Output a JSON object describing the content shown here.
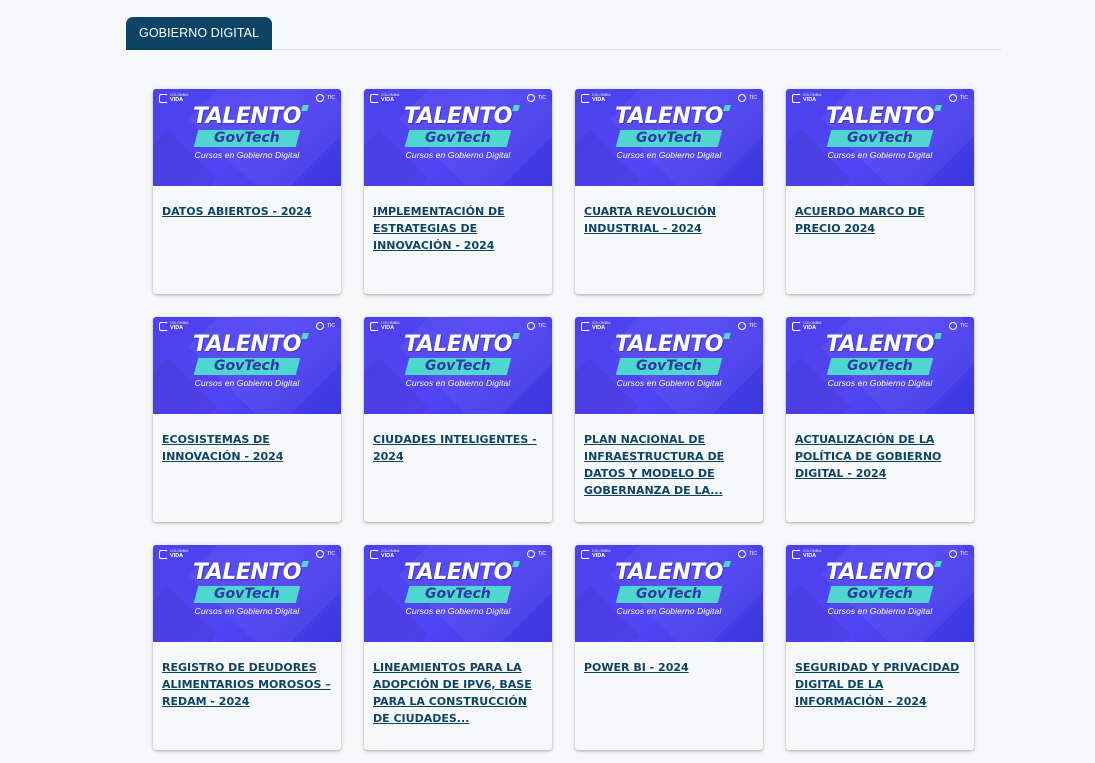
{
  "tab": {
    "label": "GOBIERNO DIGITAL"
  },
  "banner": {
    "logo_left_small": "COLOMBIA",
    "logo_left_big": "VIDA",
    "logo_right": "TIC",
    "brand": "TALENTO",
    "brand_sub": "GovTech",
    "caption": "Cursos en Gobierno Digital"
  },
  "courses": [
    {
      "title": "DATOS ABIERTOS - 2024"
    },
    {
      "title": "IMPLEMENTACIÓN DE ESTRATEGIAS DE INNOVACIÓN - 2024"
    },
    {
      "title": "CUARTA REVOLUCIÓN INDUSTRIAL - 2024"
    },
    {
      "title": "ACUERDO MARCO DE PRECIO 2024"
    },
    {
      "title": "ECOSISTEMAS DE INNOVACIÓN - 2024"
    },
    {
      "title": "CIUDADES INTELIGENTES - 2024"
    },
    {
      "title": "PLAN NACIONAL DE INFRAESTRUCTURA DE DATOS Y MODELO DE GOBERNANZA DE LA..."
    },
    {
      "title": "ACTUALIZACIÓN DE LA POLÍTICA DE GOBIERNO DIGITAL - 2024"
    },
    {
      "title": "REGISTRO DE DEUDORES ALIMENTARIOS MOROSOS – REDAM - 2024"
    },
    {
      "title": "LINEAMIENTOS PARA LA ADOPCIÓN DE IPV6, BASE PARA LA CONSTRUCCIÓN DE CIUDADES..."
    },
    {
      "title": "POWER BI - 2024"
    },
    {
      "title": "SEGURIDAD Y PRIVACIDAD DIGITAL DE LA INFORMACIÓN - 2024"
    }
  ]
}
